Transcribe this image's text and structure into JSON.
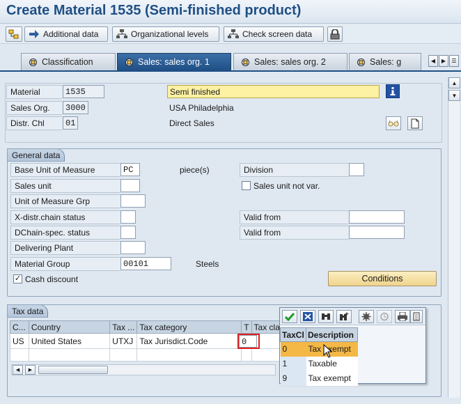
{
  "title": "Create Material 1535 (Semi-finished product)",
  "toolbar": {
    "additional_data": "Additional data",
    "org_levels": "Organizational levels",
    "check_screen": "Check screen data"
  },
  "tabs": [
    {
      "label": "Classification"
    },
    {
      "label": "Sales: sales org. 1"
    },
    {
      "label": "Sales: sales org. 2"
    },
    {
      "label": "Sales: g"
    }
  ],
  "header": {
    "material_label": "Material",
    "material_value": "1535",
    "material_desc": "Semi finished",
    "sales_org_label": "Sales Org.",
    "sales_org_value": "3000",
    "sales_org_desc": "USA Philadelphia",
    "distr_chl_label": "Distr. Chl",
    "distr_chl_value": "01",
    "distr_chl_desc": "Direct Sales"
  },
  "general": {
    "title": "General data",
    "base_uom_label": "Base Unit of Measure",
    "base_uom_value": "PC",
    "base_uom_desc": "piece(s)",
    "division_label": "Division",
    "division_value": "",
    "sales_unit_label": "Sales unit",
    "sales_unit_not_var_label": "Sales unit not var.",
    "uom_grp_label": "Unit of Measure Grp",
    "xdistr_label": "X-distr.chain status",
    "valid_from_label": "Valid from",
    "dchain_label": "DChain-spec. status",
    "valid_from2_label": "Valid from",
    "deliv_plant_label": "Delivering Plant",
    "mat_group_label": "Material Group",
    "mat_group_value": "00101",
    "mat_group_desc": "Steels",
    "cash_discount_label": "Cash discount",
    "cash_discount_checked": true,
    "conditions_button": "Conditions"
  },
  "tax": {
    "title": "Tax data",
    "columns": [
      "C...",
      "Country",
      "Tax ...",
      "Tax category",
      "T",
      "Tax cla"
    ],
    "rows": [
      {
        "c": "US",
        "country": "United States",
        "tax": "UTXJ",
        "category": "Tax Jurisdict.Code",
        "t": "0"
      }
    ]
  },
  "f4help": {
    "columns": [
      "TaxCl",
      "Description"
    ],
    "rows": [
      {
        "key": "0",
        "desc": "Tax exempt",
        "selected": true
      },
      {
        "key": "1",
        "desc": "Taxable",
        "selected": false
      },
      {
        "key": "9",
        "desc": "Tax exempt",
        "selected": false
      }
    ]
  }
}
